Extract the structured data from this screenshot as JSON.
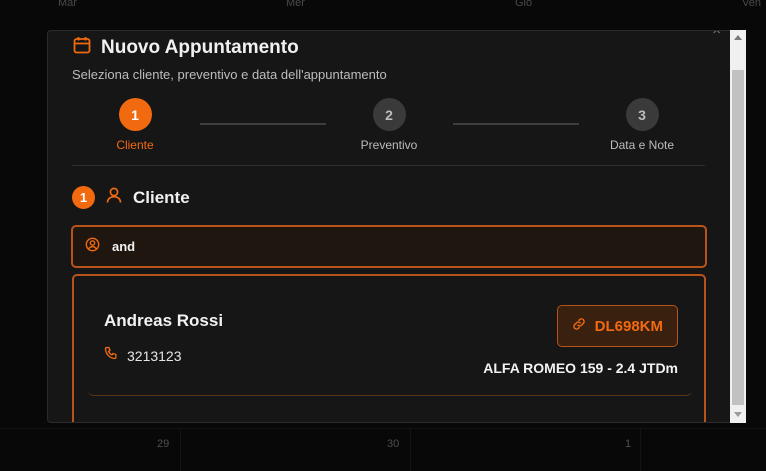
{
  "calendar": {
    "days": [
      "Mar",
      "Mer",
      "Gio",
      "Ven"
    ],
    "bottom_numbers": [
      "29",
      "30",
      "1"
    ]
  },
  "modal": {
    "close_icon": "×",
    "title": "Nuovo Appuntamento",
    "subtitle": "Seleziona cliente, preventivo e data dell'appuntamento"
  },
  "stepper": {
    "steps": [
      {
        "number": "1",
        "label": "Cliente",
        "state": "active"
      },
      {
        "number": "2",
        "label": "Preventivo",
        "state": "idle"
      },
      {
        "number": "3",
        "label": "Data e Note",
        "state": "idle"
      }
    ]
  },
  "section": {
    "number": "1",
    "title": "Cliente"
  },
  "search": {
    "value": "and"
  },
  "result": {
    "name": "Andreas Rossi",
    "phone": "3213123",
    "plate": "DL698KM",
    "vehicle": "ALFA ROMEO 159 - 2.4 JTDm"
  },
  "colors": {
    "accent": "#f26a10",
    "background": "#080808",
    "modal": "#161616"
  },
  "icons": {
    "title": "calendar-icon",
    "section": "user-icon",
    "search": "user-circle-icon",
    "phone": "phone-icon",
    "plate": "link-icon"
  }
}
